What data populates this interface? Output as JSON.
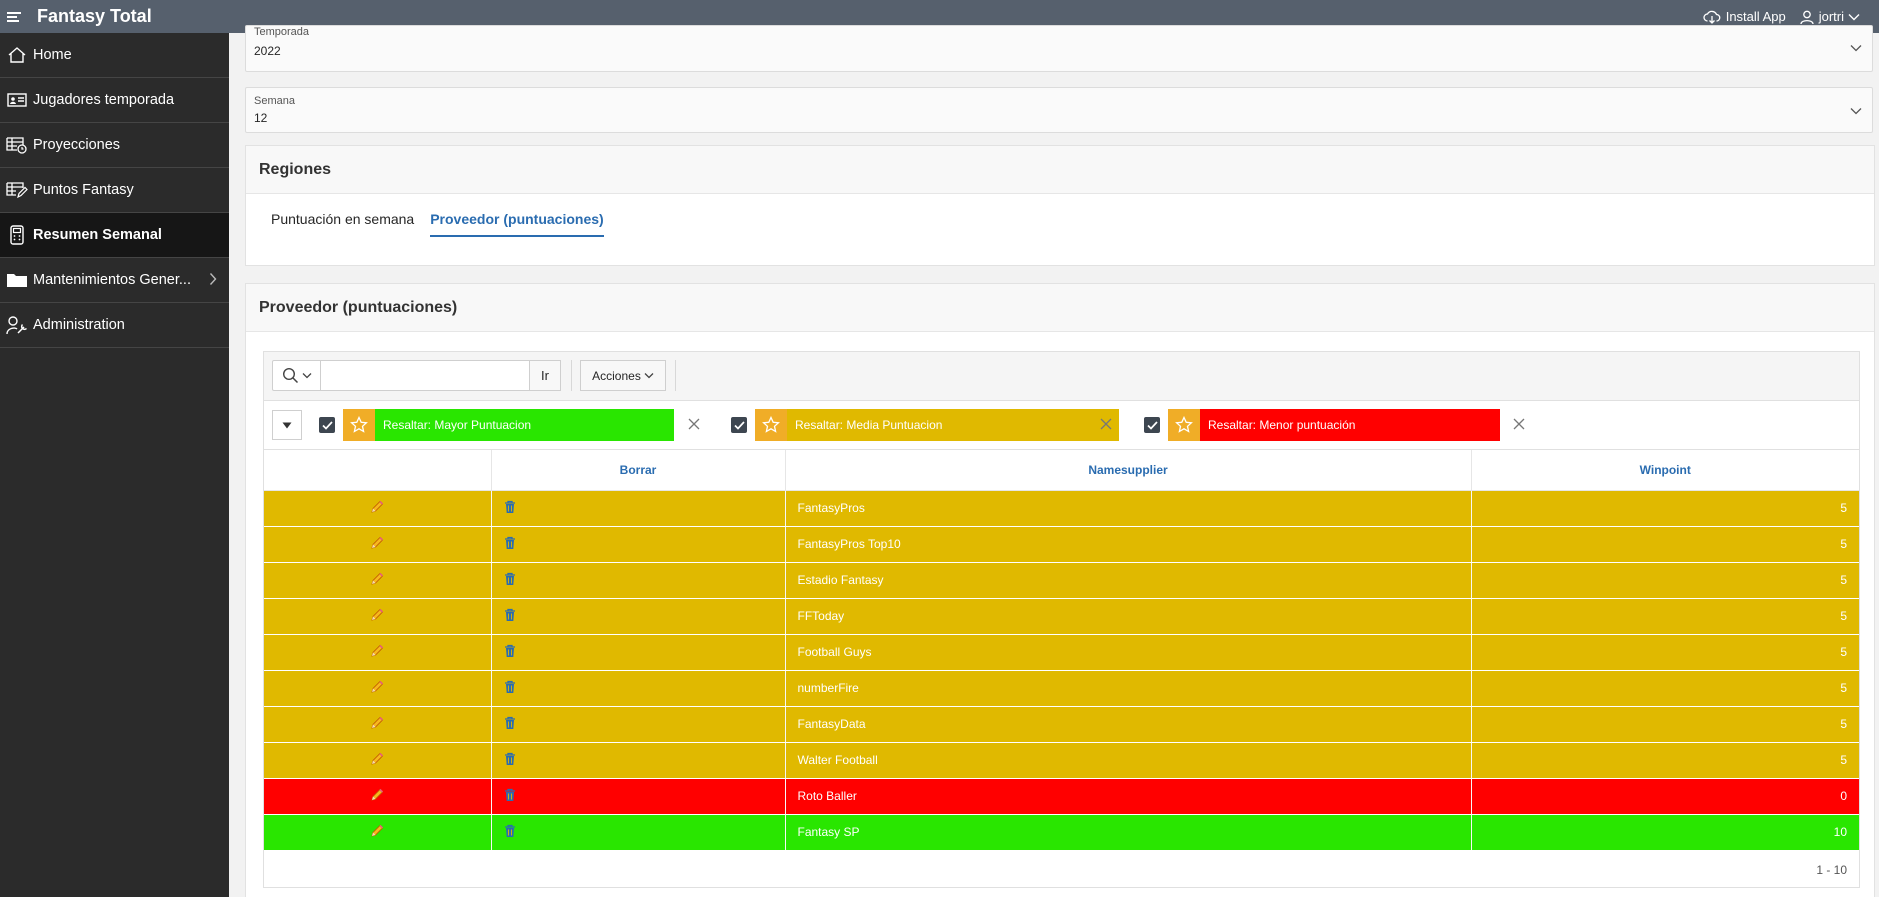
{
  "header": {
    "app_title": "Fantasy Total",
    "install_app": "Install App",
    "user": "jortri",
    "icons": [
      "menu-icon",
      "cloud-download-icon",
      "user-icon",
      "chevron-down-icon"
    ]
  },
  "sidebar": {
    "items": [
      {
        "label": "Home",
        "icon": "home-icon"
      },
      {
        "label": "Jugadores temporada",
        "icon": "id-card-icon"
      },
      {
        "label": "Proyecciones",
        "icon": "table-clock-icon"
      },
      {
        "label": "Puntos Fantasy",
        "icon": "table-edit-icon"
      },
      {
        "label": "Resumen Semanal",
        "icon": "calculator-icon",
        "active": true
      },
      {
        "label": "Mantenimientos Gener...",
        "icon": "folder-icon",
        "has_children": true
      },
      {
        "label": "Administration",
        "icon": "user-wrench-icon"
      }
    ]
  },
  "form": {
    "temporada": {
      "label": "Temporada",
      "value": "2022"
    },
    "semana": {
      "label": "Semana",
      "value": "12"
    }
  },
  "regiones": {
    "title": "Regiones",
    "tabs": [
      {
        "label": "Puntuación en semana",
        "active": false
      },
      {
        "label": "Proveedor (puntuaciones)",
        "active": true
      }
    ]
  },
  "report": {
    "title": "Proveedor (puntuaciones)",
    "go_label": "Ir",
    "actions_label": "Acciones",
    "filters": [
      {
        "label": "Resaltar: Mayor Puntuacion",
        "color": "#29e600"
      },
      {
        "label": "Resaltar: Media Puntuacion",
        "color": "#e0b900"
      },
      {
        "label": "Resaltar: Menor puntuación",
        "color": "#ff0000"
      }
    ],
    "columns": [
      "",
      "Borrar",
      "Namesupplier",
      "Winpoint"
    ],
    "rows": [
      {
        "name": "FantasyPros",
        "win": "5",
        "color": "#e0b900"
      },
      {
        "name": "FantasyPros Top10",
        "win": "5",
        "color": "#e0b900"
      },
      {
        "name": "Estadio Fantasy",
        "win": "5",
        "color": "#e0b900"
      },
      {
        "name": "FFToday",
        "win": "5",
        "color": "#e0b900"
      },
      {
        "name": "Football Guys",
        "win": "5",
        "color": "#e0b900"
      },
      {
        "name": "numberFire",
        "win": "5",
        "color": "#e0b900"
      },
      {
        "name": "FantasyData",
        "win": "5",
        "color": "#e0b900"
      },
      {
        "name": "Walter Football",
        "win": "5",
        "color": "#e0b900"
      },
      {
        "name": "Roto Baller",
        "win": "0",
        "color": "#ff0000"
      },
      {
        "name": "Fantasy SP",
        "win": "10",
        "color": "#29e600"
      }
    ],
    "pagination": "1 - 10"
  }
}
